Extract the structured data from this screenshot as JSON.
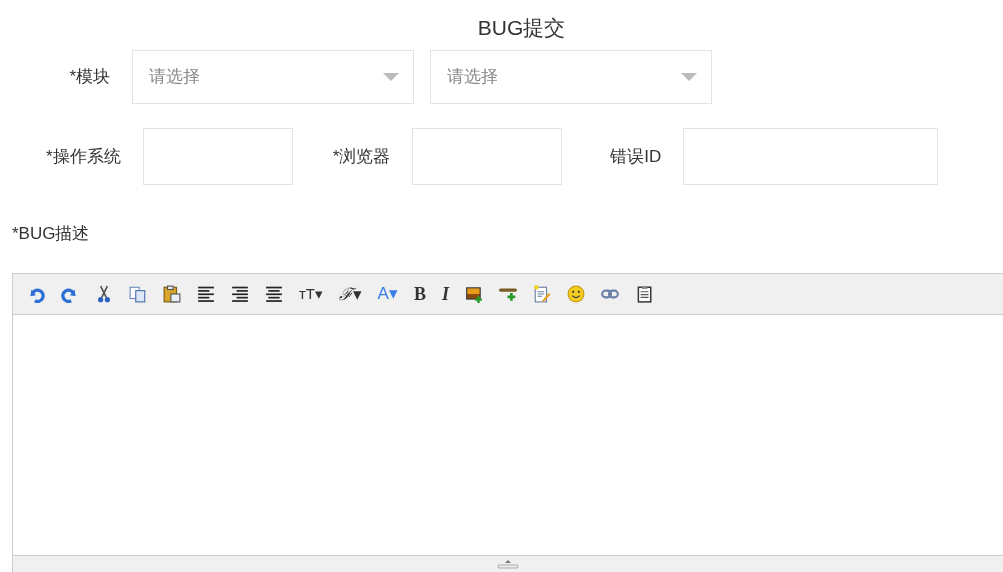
{
  "title": "BUG提交",
  "module": {
    "label": "*模块",
    "selects": [
      {
        "placeholder": "请选择"
      },
      {
        "placeholder": "请选择"
      }
    ]
  },
  "fields": [
    {
      "label": "*操作系统"
    },
    {
      "label": "*浏览器"
    },
    {
      "label": "错误ID"
    }
  ],
  "description": {
    "label": "*BUG描述"
  },
  "toolbar": [
    {
      "kind": "undo"
    },
    {
      "kind": "redo"
    },
    {
      "kind": "cut"
    },
    {
      "kind": "copy"
    },
    {
      "kind": "paste"
    },
    {
      "kind": "align-left"
    },
    {
      "kind": "align-right"
    },
    {
      "kind": "align-center"
    },
    {
      "kind": "glyph",
      "label": "тT▾"
    },
    {
      "kind": "glyph",
      "label": "ℱ▾"
    },
    {
      "kind": "glyph",
      "label": "A▾"
    },
    {
      "kind": "glyph",
      "label": "B"
    },
    {
      "kind": "glyph",
      "label": "I"
    },
    {
      "kind": "image"
    },
    {
      "kind": "rule"
    },
    {
      "kind": "note"
    },
    {
      "kind": "smiley"
    },
    {
      "kind": "link"
    },
    {
      "kind": "clipboard"
    }
  ]
}
